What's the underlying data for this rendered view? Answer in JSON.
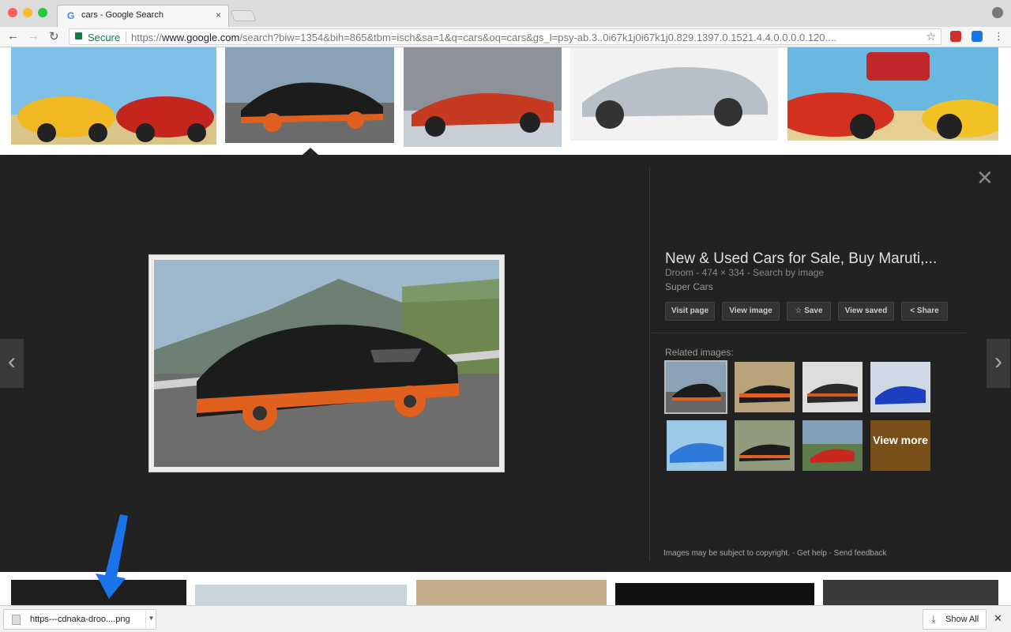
{
  "browser": {
    "tab_title": "cars - Google Search",
    "tab_close": "×",
    "tab_favicon": "G",
    "secure_label": "Secure",
    "url_prefix": "https://",
    "url_domain": "www.google.com",
    "url_rest": "/search?biw=1354&bih=865&tbm=isch&sa=1&q=cars&oq=cars&gs_l=psy-ab.3..0i67k1j0i67k1j0.829.1397.0.1521.4.4.0.0.0.0.120...."
  },
  "panel": {
    "title": "New & Used Cars for Sale, Buy Maruti,...",
    "meta": "Droom - 474 × 334 - Search by image",
    "description": "Super Cars",
    "buttons": {
      "visit": "Visit page",
      "view_image": "View image",
      "save": "Save",
      "view_saved": "View saved",
      "share": "Share"
    },
    "related_label": "Related images:",
    "view_more": "View more",
    "copyright": "Images may be subject to copyright.",
    "get_help": "Get help",
    "send_feedback": "Send feedback"
  },
  "downloads": {
    "file_name": "https---cdnaka-droo....png",
    "show_all": "Show All"
  },
  "colors": {
    "panel_bg": "#222222",
    "secure_green": "#0b8043",
    "annotation_arrow": "#1a73e8"
  }
}
